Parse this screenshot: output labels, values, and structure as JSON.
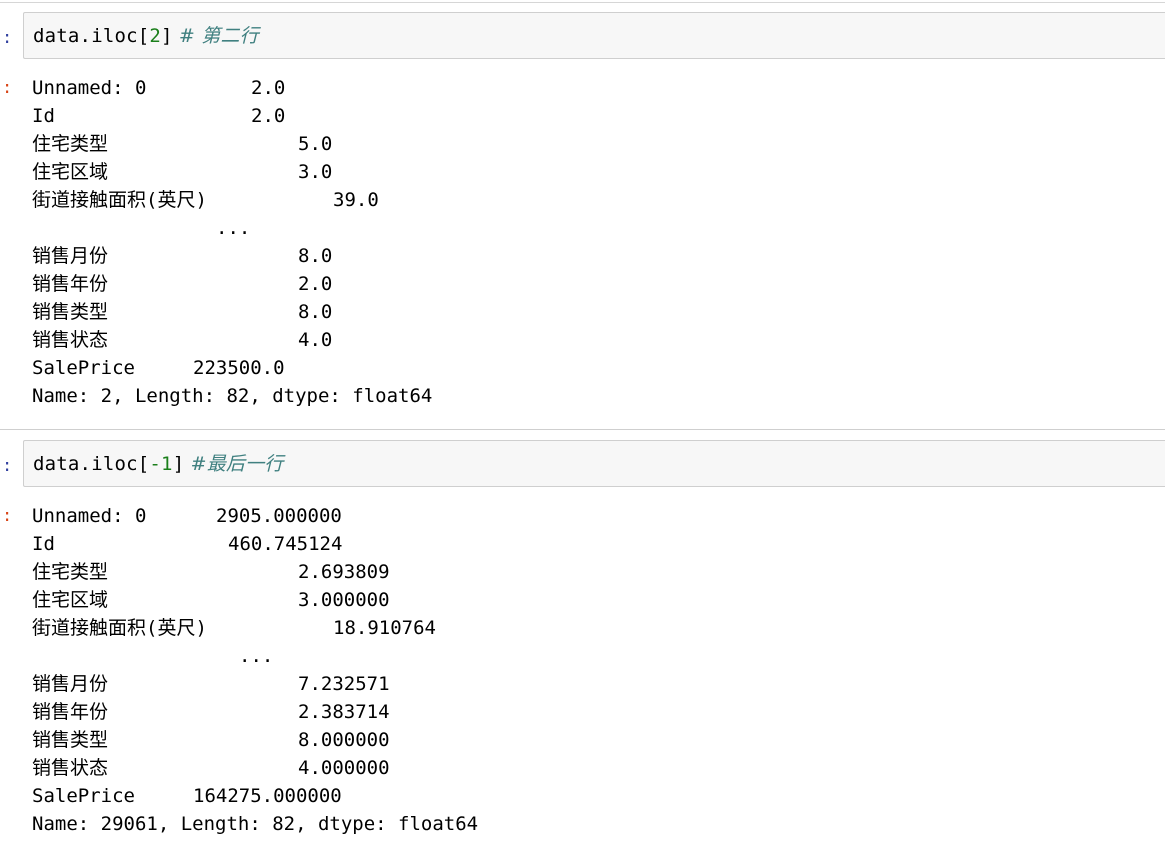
{
  "cells": [
    {
      "prompt_in": ":",
      "code": {
        "name": "data.iloc",
        "open": "[",
        "index": "2",
        "close": "]",
        "comment": " # 第二行"
      },
      "prompt_out": ":",
      "rows": [
        {
          "key": "Unnamed: 0",
          "value": "2.0"
        },
        {
          "key": "Id",
          "value": "2.0"
        },
        {
          "key": "住宅类型",
          "value": "5.0"
        },
        {
          "key": "住宅区域",
          "value": "3.0"
        },
        {
          "key": "街道接触面积(英尺)",
          "value": "39.0"
        },
        {
          "key": "",
          "value": "..."
        },
        {
          "key": "销售月份",
          "value": "8.0"
        },
        {
          "key": "销售年份",
          "value": "2.0"
        },
        {
          "key": "销售类型",
          "value": "8.0"
        },
        {
          "key": "销售状态",
          "value": "4.0"
        },
        {
          "key": "SalePrice",
          "value": "223500.0"
        }
      ],
      "footer": "Name: 2, Length: 82, dtype: float64"
    },
    {
      "prompt_in": ":",
      "code": {
        "name": "data.iloc",
        "open": "[",
        "index": "-1",
        "close": "]",
        "comment": " #最后一行"
      },
      "prompt_out": ":",
      "rows": [
        {
          "key": "Unnamed: 0",
          "value": "2905.000000"
        },
        {
          "key": "Id",
          "value": "460.745124"
        },
        {
          "key": "住宅类型",
          "value": "2.693809"
        },
        {
          "key": "住宅区域",
          "value": "3.000000"
        },
        {
          "key": "街道接触面积(英尺)",
          "value": "18.910764"
        },
        {
          "key": "",
          "value": "..."
        },
        {
          "key": "销售月份",
          "value": "7.232571"
        },
        {
          "key": "销售年份",
          "value": "2.383714"
        },
        {
          "key": "销售类型",
          "value": "8.000000"
        },
        {
          "key": "销售状态",
          "value": "4.000000"
        },
        {
          "key": "SalePrice",
          "value": "164275.000000"
        }
      ],
      "footer": "Name: 29061, Length: 82, dtype: float64"
    }
  ]
}
